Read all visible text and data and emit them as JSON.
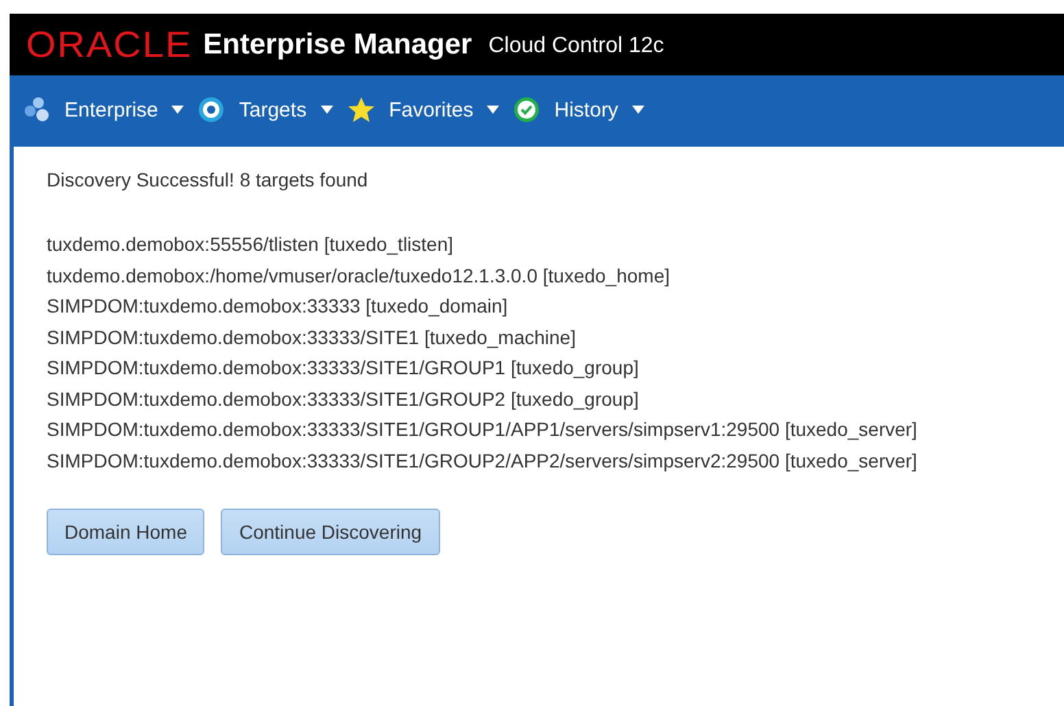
{
  "header": {
    "brand": "ORACLE",
    "product": "Enterprise Manager",
    "edition": "Cloud Control 12c"
  },
  "menu": [
    {
      "kind": "enterprise",
      "label": "Enterprise"
    },
    {
      "kind": "targets",
      "label": "Targets"
    },
    {
      "kind": "favorites",
      "label": "Favorites"
    },
    {
      "kind": "history",
      "label": "History"
    }
  ],
  "message": "Discovery Successful! 8 targets found",
  "targets": [
    "tuxdemo.demobox:55556/tlisten [tuxedo_tlisten]",
    "tuxdemo.demobox:/home/vmuser/oracle/tuxedo12.1.3.0.0 [tuxedo_home]",
    "SIMPDOM:tuxdemo.demobox:33333 [tuxedo_domain]",
    "SIMPDOM:tuxdemo.demobox:33333/SITE1 [tuxedo_machine]",
    "SIMPDOM:tuxdemo.demobox:33333/SITE1/GROUP1 [tuxedo_group]",
    "SIMPDOM:tuxdemo.demobox:33333/SITE1/GROUP2 [tuxedo_group]",
    "SIMPDOM:tuxdemo.demobox:33333/SITE1/GROUP1/APP1/servers/simpserv1:29500 [tuxedo_server]",
    "SIMPDOM:tuxdemo.demobox:33333/SITE1/GROUP2/APP2/servers/simpserv2:29500 [tuxedo_server]"
  ],
  "buttons": [
    "Domain Home",
    "Continue Discovering"
  ]
}
